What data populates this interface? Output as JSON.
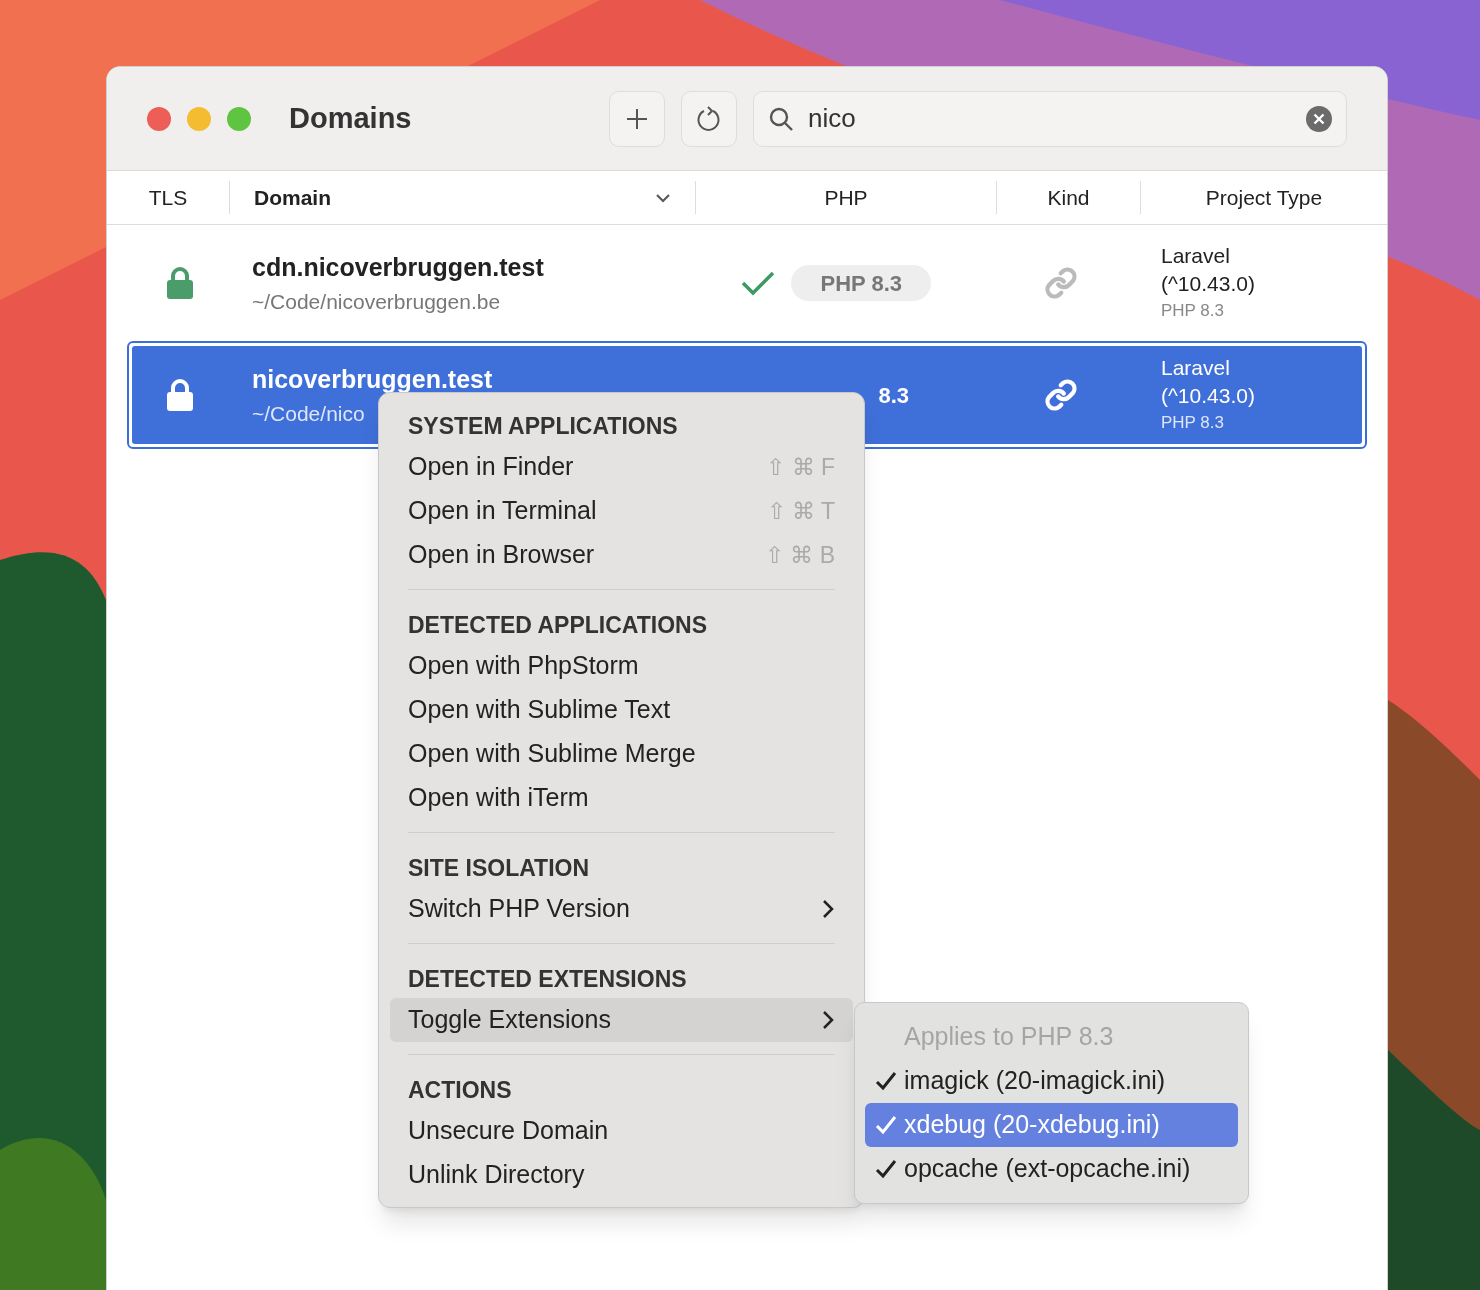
{
  "window": {
    "title": "Domains"
  },
  "search": {
    "value": "nico"
  },
  "columns": [
    {
      "label": "TLS",
      "sortable": false
    },
    {
      "label": "Domain",
      "sortable": true
    },
    {
      "label": "PHP",
      "sortable": false
    },
    {
      "label": "Kind",
      "sortable": false
    },
    {
      "label": "Project Type",
      "sortable": false
    }
  ],
  "rows": [
    {
      "domain": "cdn.nicoverbruggen.test",
      "path": "~/Code/nicoverbruggen.be",
      "secure": true,
      "verified": true,
      "php": "PHP 8.3",
      "project": "Laravel (^10.43.0)",
      "project_php": "PHP 8.3",
      "selected": false
    },
    {
      "domain": "nicoverbruggen.test",
      "path": "~/Code/nico",
      "secure": true,
      "php": "8.3",
      "project": "Laravel (^10.43.0)",
      "project_php": "PHP 8.3",
      "selected": true
    }
  ],
  "context_menu": {
    "sections": [
      {
        "header": "SYSTEM APPLICATIONS",
        "items": [
          {
            "label": "Open in Finder",
            "shortcut": "⇧ ⌘ F",
            "submenu": false,
            "highlighted": false
          },
          {
            "label": "Open in Terminal",
            "shortcut": "⇧ ⌘ T",
            "submenu": false,
            "highlighted": false
          },
          {
            "label": "Open in Browser",
            "shortcut": "⇧ ⌘ B",
            "submenu": false,
            "highlighted": false
          }
        ]
      },
      {
        "header": "DETECTED APPLICATIONS",
        "items": [
          {
            "label": "Open with PhpStorm",
            "submenu": false,
            "highlighted": false
          },
          {
            "label": "Open with Sublime Text",
            "submenu": false,
            "highlighted": false
          },
          {
            "label": "Open with Sublime Merge",
            "submenu": false,
            "highlighted": false
          },
          {
            "label": "Open with iTerm",
            "submenu": false,
            "highlighted": false
          }
        ]
      },
      {
        "header": "SITE ISOLATION",
        "items": [
          {
            "label": "Switch PHP Version",
            "submenu": true,
            "highlighted": false
          }
        ]
      },
      {
        "header": "DETECTED EXTENSIONS",
        "items": [
          {
            "label": "Toggle Extensions",
            "submenu": true,
            "highlighted": true
          }
        ]
      },
      {
        "header": "ACTIONS",
        "items": [
          {
            "label": "Unsecure Domain",
            "submenu": false,
            "highlighted": false
          },
          {
            "label": "Unlink Directory",
            "submenu": false,
            "highlighted": false
          }
        ]
      }
    ]
  },
  "submenu": {
    "title": "Applies to PHP 8.3",
    "items": [
      {
        "label": "imagick (20-imagick.ini)",
        "checked": true,
        "selected": false
      },
      {
        "label": "xdebug (20-xdebug.ini)",
        "checked": true,
        "selected": true
      },
      {
        "label": "opcache (ext-opcache.ini)",
        "checked": true,
        "selected": false
      }
    ]
  }
}
